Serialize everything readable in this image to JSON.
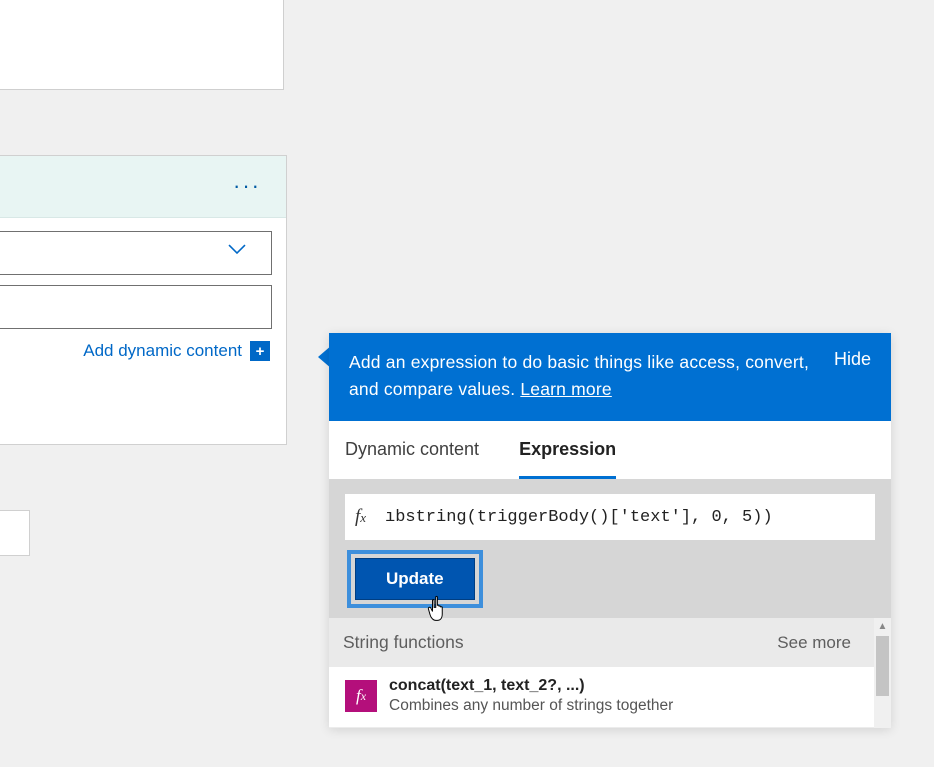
{
  "left_card": {
    "add_dynamic_label": "Add dynamic content"
  },
  "flyout": {
    "header_text": "Add an expression to do basic things like access, convert, and compare values. ",
    "learn_more": "Learn more",
    "hide": "Hide",
    "tabs": {
      "dynamic": "Dynamic content",
      "expression": "Expression"
    },
    "expression_value": "ıbstring(triggerBody()['text'], 0, 5))",
    "update": "Update",
    "group_label": "String functions",
    "see_more": "See more",
    "function": {
      "signature": "concat(text_1, text_2?, ...)",
      "description": "Combines any number of strings together"
    }
  }
}
